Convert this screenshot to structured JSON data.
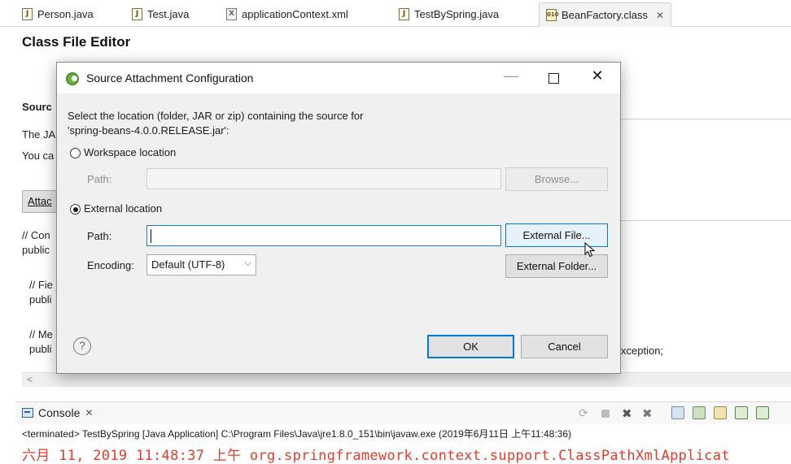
{
  "tabs": [
    {
      "label": "Person.java",
      "icon": "java-file-icon"
    },
    {
      "label": "Test.java",
      "icon": "java-file-icon"
    },
    {
      "label": "applicationContext.xml",
      "icon": "xml-file-icon"
    },
    {
      "label": "TestBySpring.java",
      "icon": "java-file-icon"
    },
    {
      "label": "BeanFactory.class",
      "icon": "class-file-icon",
      "active": true
    }
  ],
  "editor": {
    "title": "Class File Editor",
    "source_heading": "Sourc",
    "line_the_jar": "The JA",
    "line_you_can": "You ca",
    "attach_button": "Attac",
    "code": {
      "compiled_comment": "// Con",
      "public_line": "public",
      "fields_comment": "// Fie",
      "fields_public": "publi",
      "methods_comment": "// Me",
      "methods_public": "publi",
      "exception_tail": "xception;"
    }
  },
  "dialog": {
    "title": "Source Attachment Configuration",
    "description_line1": "Select the location (folder, JAR or zip) containing the source for",
    "description_line2": "'spring-beans-4.0.0.RELEASE.jar':",
    "workspace": {
      "label": "Workspace location",
      "selected": false,
      "path_label": "Path:",
      "path_value": "",
      "browse_button": "Browse..."
    },
    "external": {
      "label": "External location",
      "selected": true,
      "path_label": "Path:",
      "path_value": "",
      "file_button": "External File...",
      "folder_button": "External Folder...",
      "encoding_label": "Encoding:",
      "encoding_value": "Default (UTF-8)"
    },
    "ok_button": "OK",
    "cancel_button": "Cancel",
    "help_glyph": "?",
    "window_controls": {
      "minimize": "—",
      "close": "✕"
    }
  },
  "console": {
    "tab_label": "Console",
    "terminated_line": "<terminated> TestBySpring [Java Application] C:\\Program Files\\Java\\jre1.8.0_151\\bin\\javaw.exe (2019年6月11日 上午11:48:36)",
    "log_line": "六月 11, 2019 11:48:37 上午 org.springframework.context.support.ClassPathXmlApplicat"
  },
  "colors": {
    "accent": "#0078d7",
    "log_text": "#e03c2b",
    "dialog_bg": "#f0f0f0"
  }
}
